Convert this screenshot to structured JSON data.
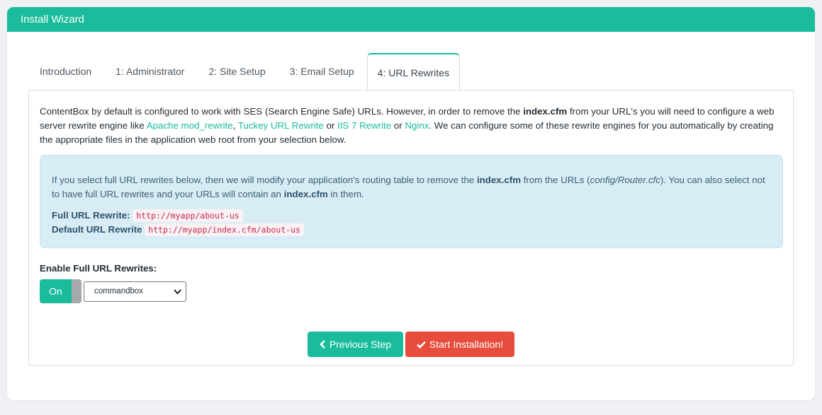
{
  "header": {
    "title": "Install Wizard"
  },
  "tabs": [
    {
      "label": "Introduction",
      "active": false
    },
    {
      "label": "1: Administrator",
      "active": false
    },
    {
      "label": "2: Site Setup",
      "active": false
    },
    {
      "label": "3: Email Setup",
      "active": false
    },
    {
      "label": "4: URL Rewrites",
      "active": true
    }
  ],
  "intro": {
    "t1": "ContentBox by default is configured to work with SES (Search Engine Safe) URLs. However, in order to remove the ",
    "b1": "index.cfm",
    "t2": " from your URL's you will need to configure a web server rewrite engine like ",
    "link_apache": "Apache mod_rewrite",
    "t3": ", ",
    "link_tuckey": "Tuckey URL Rewrite",
    "t4": " or ",
    "link_iis": "IIS 7 Rewrite",
    "t5": " or ",
    "link_nginx": "Nginx",
    "t6": ". We can configure some of these rewrite engines for you automatically by creating the appropriate files in the application web root from your selection below."
  },
  "info": {
    "t1": "If you select full URL rewrites below, then we will modify your application's routing table to remove the ",
    "b1": "index.cfm",
    "t2": " from the URLs (",
    "i1": "config/Router.cfc",
    "t3": "). You can also select not to have full URL rewrites and your URLs will contain an ",
    "b2": "index.cfm",
    "t4": " in them.",
    "full_label": "Full URL Rewrite:",
    "full_value": "http://myapp/about-us",
    "default_label": "Default URL Rewrite",
    "default_value": "http://myapp/index.cfm/about-us"
  },
  "form": {
    "enable_label": "Enable Full URL Rewrites:",
    "toggle_label": "On",
    "toggle_state": true,
    "engine_selected": "commandbox"
  },
  "buttons": {
    "previous": "Previous Step",
    "start": "Start Installation!"
  },
  "colors": {
    "accent": "#1abc9c",
    "danger": "#e74c3c",
    "info_bg": "#d8ecf6",
    "code": "#c7254e"
  }
}
